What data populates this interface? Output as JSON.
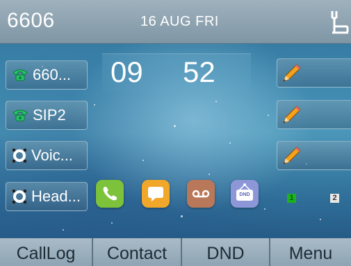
{
  "status_bar": {
    "extension": "6606",
    "date": "16 AUG FRI",
    "network_icon": "ethernet-network-icon"
  },
  "clock": {
    "hours": "09",
    "minutes": "52"
  },
  "line_keys_left": [
    {
      "label": "660...",
      "icon": "green-phone-icon"
    },
    {
      "label": "SIP2",
      "icon": "green-phone-icon"
    },
    {
      "label": "Voic...",
      "icon": "voicemail-ring-icon"
    },
    {
      "label": "Head...",
      "icon": "headset-ring-icon"
    }
  ],
  "line_keys_right": [
    {
      "label": "",
      "icon": "pencil-icon"
    },
    {
      "label": "",
      "icon": "pencil-icon"
    },
    {
      "label": "",
      "icon": "pencil-icon"
    }
  ],
  "apps": [
    {
      "name": "phone-app-icon",
      "color": "#7cc23a"
    },
    {
      "name": "message-app-icon",
      "color": "#f1a72a"
    },
    {
      "name": "voicemail-app-icon",
      "color": "#b9785a"
    },
    {
      "name": "dnd-app-icon",
      "color": "#8d97d8",
      "text": "DND"
    }
  ],
  "pages": [
    "1",
    "2"
  ],
  "softkeys": [
    "CallLog",
    "Contact",
    "DND",
    "Menu"
  ]
}
